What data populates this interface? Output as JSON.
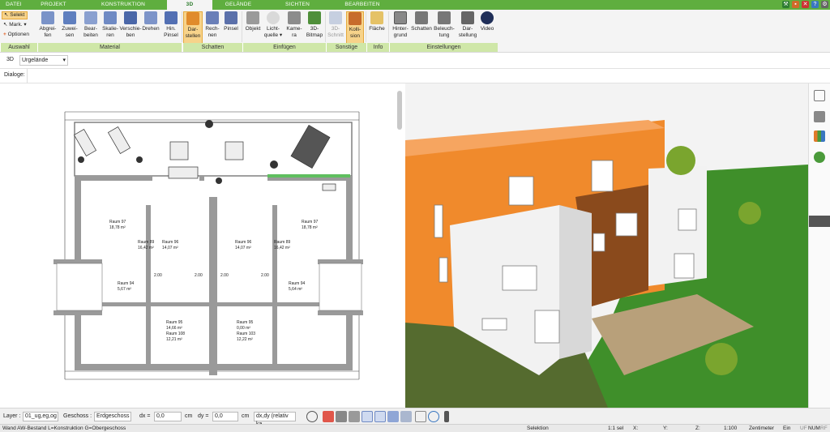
{
  "tabs": [
    "DATEI",
    "PROJEKT",
    "KONSTRUKTION",
    "3D",
    "GELÄNDE",
    "SICHTEN",
    "BEARBEITEN"
  ],
  "active_tab": "3D",
  "ribbon": {
    "auswahl": {
      "selekt": "Selekt",
      "mark": "Mark.",
      "optionen": "Optionen"
    },
    "material": [
      "Abgrei-\nfen",
      "Zuwei-\nsen",
      "Bear-\nbeiten",
      "Skalie-\nren",
      "Verschie-\nben",
      "Drehen",
      "Hin.\nPinsel"
    ],
    "schatten": [
      "Dar-\nstellen",
      "Rech-\nnen",
      "Pinsel"
    ],
    "einfuegen": [
      "Objekt",
      "Licht-\nquelle ▾",
      "Kame-\nra",
      "3D-\nBitmap"
    ],
    "sonstige": [
      "3D-\nSchnitt",
      "Kolli-\nsion"
    ],
    "info": [
      "Fläche"
    ],
    "einstellungen": [
      "Hinter-\ngrund",
      "Schatten",
      "Beleuch-\ntung",
      "Dar-\nstellung",
      "Video"
    ],
    "groups": [
      "Auswahl",
      "Material",
      "Schatten",
      "Einfügen",
      "Sonstige",
      "Info",
      "Einstellungen"
    ]
  },
  "section": {
    "mode": "3D",
    "dropdown": "Urgelände"
  },
  "dialoge": "Dialoge:",
  "plan": {
    "rooms": [
      {
        "name": "Raum 97",
        "area": "18,78 m²"
      },
      {
        "name": "Raum 89",
        "area": "16,42 m²"
      },
      {
        "name": "Raum 96",
        "area": "14,07 m²"
      },
      {
        "name": "Raum 96",
        "area": "14,07 m²"
      },
      {
        "name": "Raum 89",
        "area": "16,42 m²"
      },
      {
        "name": "Raum 97",
        "area": "18,78 m²"
      },
      {
        "name": "Raum 94",
        "area": "5,67 m²"
      },
      {
        "name": "Raum 94",
        "area": "5,64 m²"
      },
      {
        "name": "Raum 95",
        "area": "14,66 m²"
      },
      {
        "name": "Raum 108",
        "area": "12,21 m²"
      },
      {
        "name": "Raum 95",
        "area": "0,00 m²"
      },
      {
        "name": "Raum 103",
        "area": "12,22 m²"
      }
    ],
    "dims": [
      "2.00",
      "2.00",
      "2.00",
      "2.00"
    ]
  },
  "bottom": {
    "layer_label": "Layer :",
    "layer_value": "01_ug,eg,og",
    "geschoss_label": "Geschoss :",
    "geschoss_value": "Erdgeschoss",
    "dx_label": "dx =",
    "dx_value": "0,0",
    "dx_unit": "cm",
    "dy_label": "dy =",
    "dy_value": "0,0",
    "dy_unit": "cm",
    "mode_value": "dx,dy (relativ ka"
  },
  "status": {
    "left": "Wand AW-Bestand L=Konstruktion G=Obergeschoss",
    "selektion": "Selektion",
    "sel": "1:1 sel",
    "x": "X:",
    "y": "Y:",
    "z": "Z:",
    "scale": "1:100",
    "unit": "Zentimeter",
    "ein": "Ein",
    "uf": "UF",
    "num": "NUM",
    "rf": "RF"
  },
  "colors": {
    "green": "#5fae3f",
    "facade_orange": "#f08a2c",
    "facade_white": "#f2f2f2",
    "wood": "#8a4a1c",
    "lawn": "#3f8f2a",
    "sky": "#f3f3f3"
  }
}
